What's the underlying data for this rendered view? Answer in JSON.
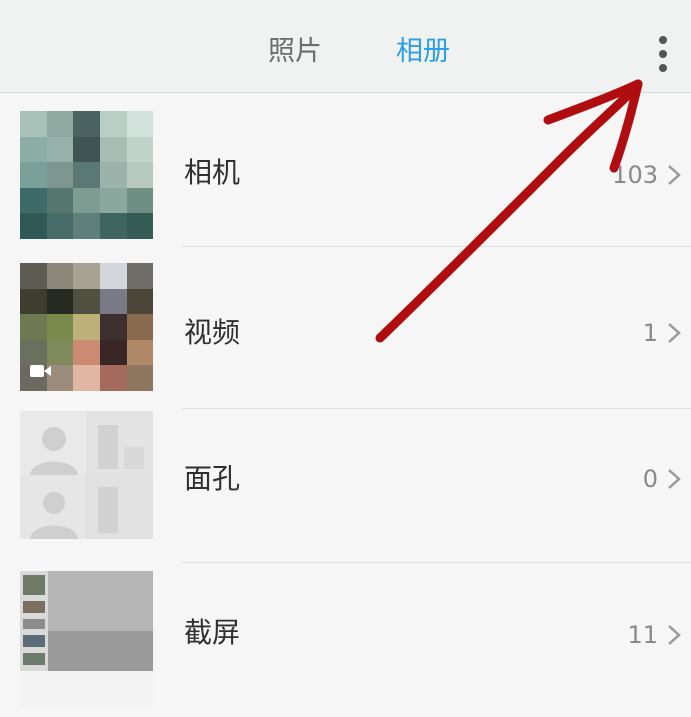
{
  "tabs": [
    {
      "label": "照片",
      "active": false
    },
    {
      "label": "相册",
      "active": true
    }
  ],
  "accent_color": "#2e9fe6",
  "more_icon": "more-vertical-icon",
  "albums": [
    {
      "name": "相机",
      "count": "103"
    },
    {
      "name": "视频",
      "count": "1"
    },
    {
      "name": "面孔",
      "count": "0"
    },
    {
      "name": "截屏",
      "count": "11"
    }
  ],
  "annotation": {
    "type": "hand-drawn-arrow",
    "color": "#b00d10",
    "points_to": "more-options-button"
  }
}
